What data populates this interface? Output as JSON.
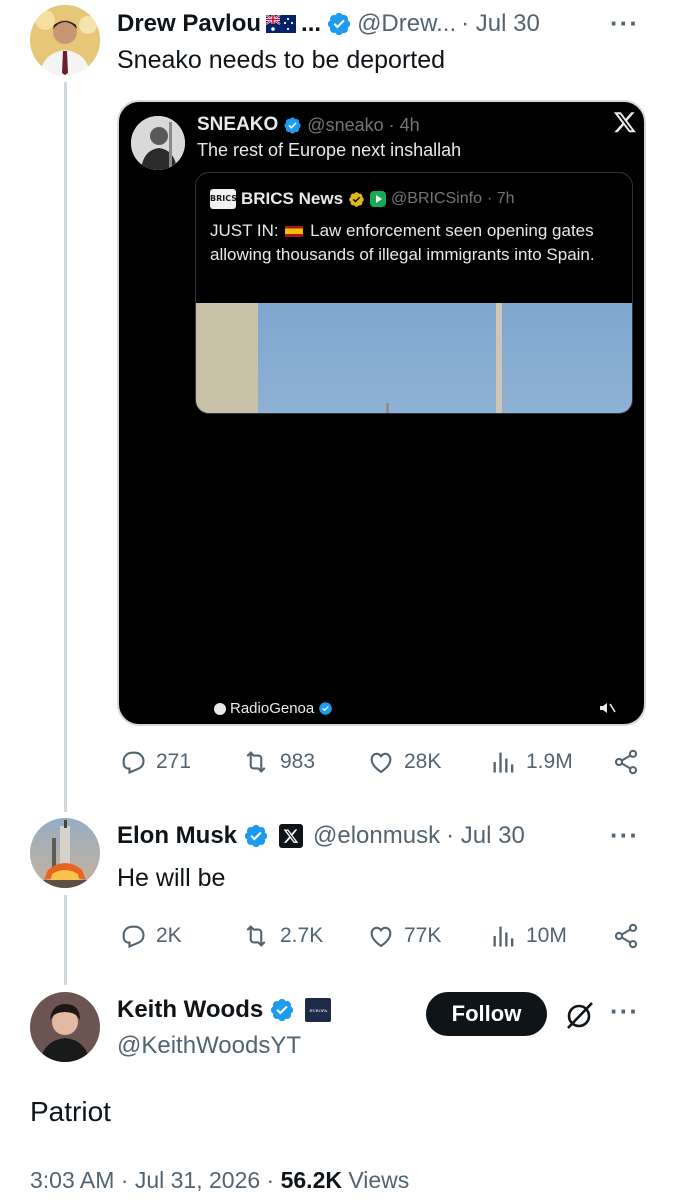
{
  "tweet1": {
    "name": "Drew Pavlou",
    "name_suffix": "...",
    "handle": "@Drew...",
    "date": "· Jul 30",
    "text": "Sneako needs to be deported",
    "embed": {
      "name": "SNEAKO",
      "handle": "@sneako",
      "time": "· 4h",
      "text": "The rest of Europe next inshallah",
      "x_logo": "X",
      "quote": {
        "logo_text": "BRICS",
        "name": "BRICS News",
        "handle": "@BRICSinfo",
        "time": "· 7h",
        "prefix": "JUST IN:",
        "text": "Law enforcement seen opening gates allowing thousands of illegal immigrants into Spain."
      },
      "video_credit": "RadioGenoa"
    },
    "stats": {
      "replies": "271",
      "reposts": "983",
      "likes": "28K",
      "views": "1.9M"
    }
  },
  "tweet2": {
    "name": "Elon Musk",
    "x_badge": "X",
    "handle": "@elonmusk",
    "date": "· Jul 30",
    "text": "He will be",
    "stats": {
      "replies": "2K",
      "reposts": "2.7K",
      "likes": "77K",
      "views": "10M"
    }
  },
  "tweet3": {
    "name": "Keith Woods",
    "badge": "EUROPA",
    "handle": "@KeithWoodsYT",
    "follow_label": "Follow",
    "text": "Patriot",
    "time": "3:03 AM · Jul 31, 2026 ·",
    "views_count": "56.2K",
    "views_label": "Views"
  },
  "colors": {
    "verified": "#1d9bf0",
    "gold_verified": "#e2b719",
    "text": "#0f1419",
    "muted": "#536471",
    "thread_line": "#cfd9de"
  },
  "icons": [
    "verified-badge-icon",
    "reply-icon",
    "repost-icon",
    "like-icon",
    "views-icon",
    "share-icon",
    "more-icon",
    "x-logo-icon",
    "grok-icon",
    "mute-icon"
  ]
}
